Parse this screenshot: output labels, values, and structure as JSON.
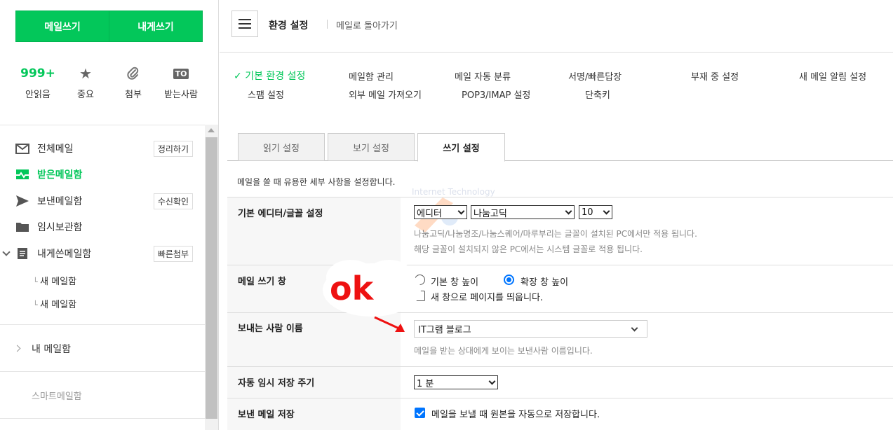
{
  "sidebar": {
    "write_mail": "메일쓰기",
    "write_to_me": "내게쓰기",
    "quick": [
      {
        "icon": "999+",
        "label": "안읽음"
      },
      {
        "icon": "★",
        "label": "중요"
      },
      {
        "icon": "paperclip",
        "label": "첨부"
      },
      {
        "icon": "TO",
        "label": "받는사람"
      }
    ],
    "folders": [
      {
        "label": "전체메일",
        "action": "정리하기"
      },
      {
        "label": "받은메일함"
      },
      {
        "label": "보낸메일함",
        "action": "수신확인"
      },
      {
        "label": "임시보관함"
      },
      {
        "label": "내게쓴메일함",
        "action": "빠른첨부"
      }
    ],
    "subfolders": [
      "새 메일함",
      "새 메일함"
    ],
    "my_mailbox": "내 메일함",
    "smart_mailbox": "스마트메일함"
  },
  "header": {
    "title": "환경 설정",
    "back_link": "메일로 돌아가기"
  },
  "settings_nav": {
    "row1": [
      "기본 환경 설정",
      "메일함 관리",
      "메일 자동 분류",
      "서명/빠른답장",
      "부재 중 설정",
      "새 메일 알림 설정"
    ],
    "row2": [
      "스팸 설정",
      "외부 메일 가져오기",
      "POP3/IMAP 설정",
      "단축키"
    ],
    "check_mark": "✓"
  },
  "tabs": [
    "읽기 설정",
    "보기 설정",
    "쓰기 설정"
  ],
  "description": "메일을 쓸 때 유용한 세부 사항을 설정합니다.",
  "rows": {
    "editor": {
      "label": "기본 에디터/글꼴 설정",
      "editor_value": "에디터",
      "font_value": "나눔고딕",
      "size_value": "10",
      "note1": "나눔고딕/나눔명조/나눔스퀘어/마루부리는 글꼴이 설치된 PC에서만 적용 됩니다.",
      "note2": "해당 글꼴이 설치되지 않은 PC에서는 시스템 글꼴로 적용 됩니다."
    },
    "compose_window": {
      "label": "메일 쓰기 창",
      "option1": "기본 창 높이",
      "option2": "확장 창 높이",
      "new_window": "새 창으로 페이지를 띄웁니다."
    },
    "sender": {
      "label": "보내는 사람 이름",
      "value": "IT그램 블로그",
      "note": "메일을 받는 상대에게 보이는 보낸사람 이름입니다."
    },
    "autosave": {
      "label": "자동 임시 저장 주기",
      "value": "1 분"
    },
    "save_sent": {
      "label": "보낸 메일 저장",
      "option": "메일을 보낼 때 원본을 자동으로 저장합니다."
    }
  },
  "annotation": {
    "text": "ok",
    "watermark_text": "Internet Technology"
  },
  "colors": {
    "brand": "#03c75a",
    "annotation": "#ee1111",
    "checkbox": "#0075ff"
  }
}
